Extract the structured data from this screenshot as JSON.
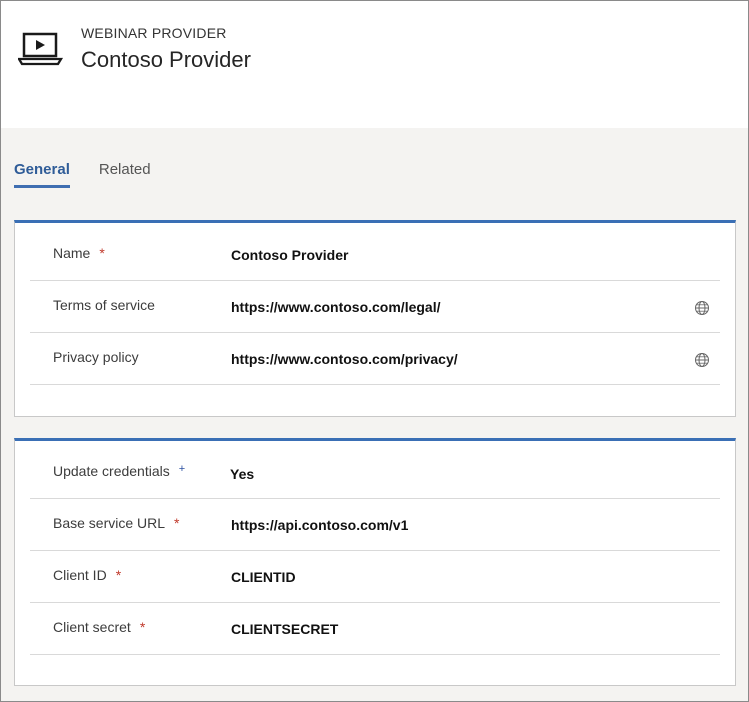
{
  "header": {
    "icon": "laptop-play-icon",
    "entity_type": "WEBINAR PROVIDER",
    "title": "Contoso Provider"
  },
  "tabs": [
    {
      "label": "General",
      "active": true
    },
    {
      "label": "Related",
      "active": false
    }
  ],
  "sections": [
    {
      "fields": [
        {
          "label": "Name",
          "required": "*",
          "value": "Contoso Provider"
        },
        {
          "label": "Terms of service",
          "value": "https://www.contoso.com/legal/",
          "icon": "globe-icon"
        },
        {
          "label": "Privacy policy",
          "value": "https://www.contoso.com/privacy/",
          "icon": "globe-icon"
        }
      ]
    },
    {
      "fields": [
        {
          "label": "Update credentials",
          "recommended": "+",
          "value": "Yes"
        },
        {
          "label": "Base service URL",
          "required": "*",
          "value": "https://api.contoso.com/v1"
        },
        {
          "label": "Client ID",
          "required": "*",
          "value": "CLIENTID"
        },
        {
          "label": "Client secret",
          "required": "*",
          "value": "CLIENTSECRET"
        }
      ]
    }
  ],
  "colors": {
    "accent": "#3a6fb5",
    "tab_active": "#2f5c98",
    "required": "#c0392b",
    "recommended": "#2b4fa0",
    "page_bg": "#f4f3f1"
  }
}
